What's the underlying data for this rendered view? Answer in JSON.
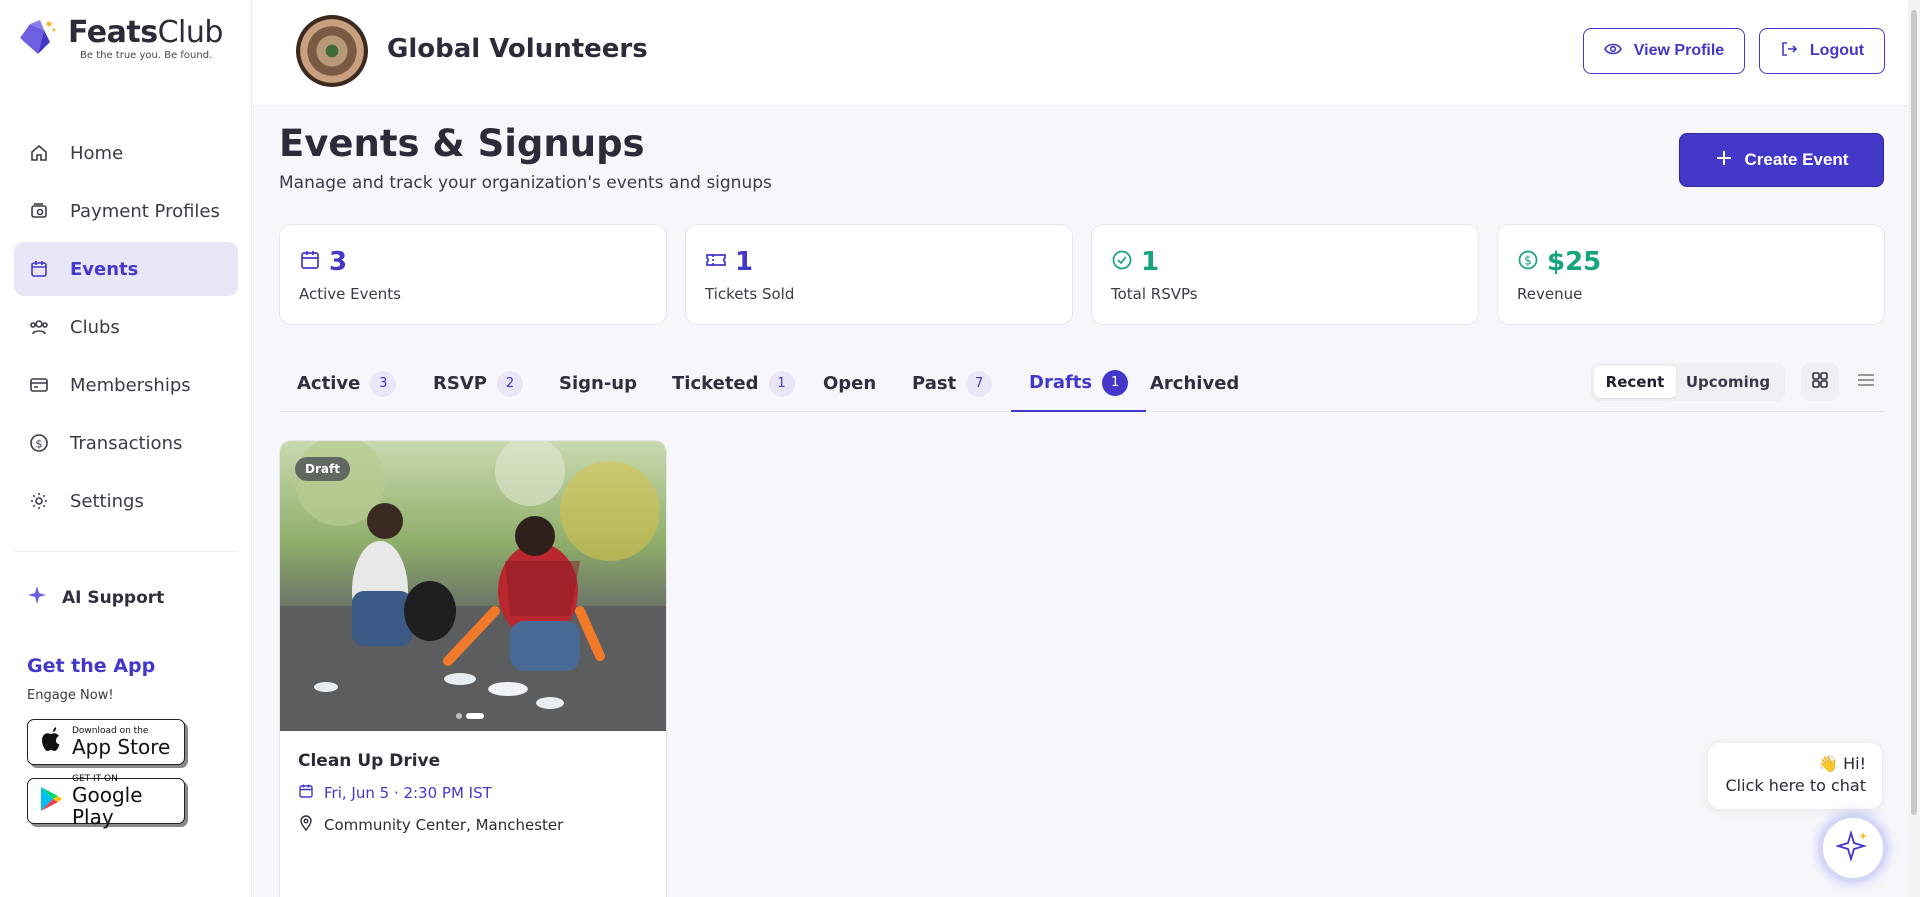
{
  "brand": {
    "name_bold": "Feats",
    "name_light": "Club",
    "tagline": "Be the true you. Be found."
  },
  "sidebar": {
    "items": [
      {
        "label": "Home",
        "icon": "home-icon"
      },
      {
        "label": "Payment Profiles",
        "icon": "wallet-icon"
      },
      {
        "label": "Events",
        "icon": "calendar-icon",
        "active": true
      },
      {
        "label": "Clubs",
        "icon": "users-icon"
      },
      {
        "label": "Memberships",
        "icon": "card-icon"
      },
      {
        "label": "Transactions",
        "icon": "dollar-icon"
      },
      {
        "label": "Settings",
        "icon": "gear-icon"
      }
    ],
    "ai_support": "AI Support",
    "get_app": "Get the App",
    "engage": "Engage Now!",
    "app_store": {
      "small": "Download on the",
      "big": "App Store"
    },
    "google_play": {
      "small": "GET IT ON",
      "big": "Google Play"
    }
  },
  "header": {
    "org_name": "Global Volunteers",
    "view_profile": "View Profile",
    "logout": "Logout"
  },
  "main": {
    "title": "Events & Signups",
    "subtitle": "Manage and track your organization's events and signups",
    "create_event": "Create Event",
    "stats": [
      {
        "value": "3",
        "label": "Active Events",
        "icon": "calendar-icon",
        "color": "#4338ca"
      },
      {
        "value": "1",
        "label": "Tickets Sold",
        "icon": "ticket-icon",
        "color": "#4338ca"
      },
      {
        "value": "1",
        "label": "Total RSVPs",
        "icon": "check-circle-icon",
        "color": "#16a37f"
      },
      {
        "value": "$25",
        "label": "Revenue",
        "icon": "dollar-circle-icon",
        "color": "#16a37f"
      }
    ],
    "tabs": [
      {
        "label": "Active",
        "count": "3"
      },
      {
        "label": "RSVP",
        "count": "2"
      },
      {
        "label": "Sign-up",
        "count": null
      },
      {
        "label": "Ticketed",
        "count": "1"
      },
      {
        "label": "Open",
        "count": null
      },
      {
        "label": "Past",
        "count": "7"
      },
      {
        "label": "Drafts",
        "count": "1",
        "active": true
      },
      {
        "label": "Archived",
        "count": null
      }
    ],
    "sort": {
      "recent": "Recent",
      "upcoming": "Upcoming",
      "selected": "Recent"
    },
    "event_card": {
      "badge": "Draft",
      "title": "Clean Up Drive",
      "date": "Fri, Jun 5 · 2:30 PM IST",
      "location": "Community Center, Manchester"
    }
  },
  "chat": {
    "greeting": "👋 Hi!",
    "prompt": "Click here to chat"
  },
  "colors": {
    "accent": "#4338ca",
    "success": "#16a37f"
  }
}
